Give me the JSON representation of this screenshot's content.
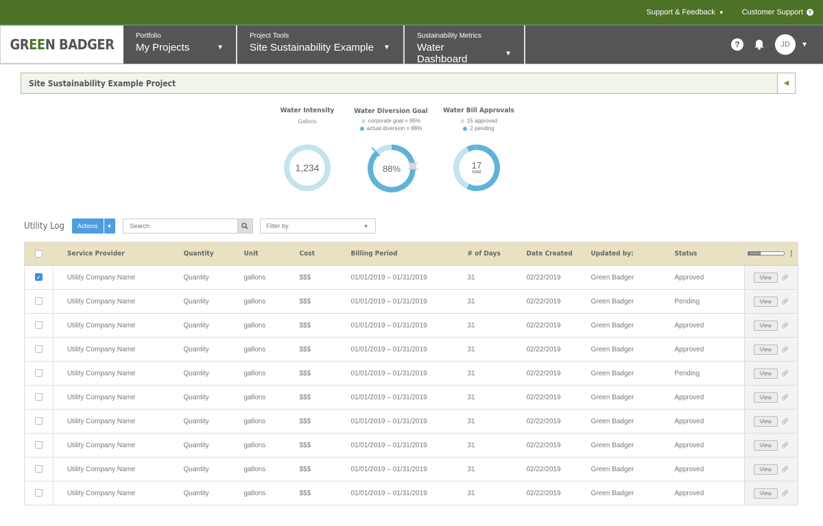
{
  "topbar": {
    "support_feedback": "Support & Feedback",
    "customer_support": "Customer Support"
  },
  "nav": {
    "logo_left": "GR",
    "logo_mid": "EE",
    "logo_right": "N BADGER",
    "sections": [
      {
        "label": "Portfolio",
        "value": "My Projects"
      },
      {
        "label": "Project Tools",
        "value": "Site Sustainability Example"
      },
      {
        "label": "Sustainability Metrics",
        "value": "Water Dashboard"
      }
    ],
    "help": "?",
    "avatar_initials": "JD"
  },
  "project": {
    "title": "Site Sustainability Example Project"
  },
  "metrics": {
    "intensity": {
      "title": "Water Intensity",
      "subtitle": "Gallons",
      "value": "1,234"
    },
    "diversion": {
      "title": "Water Diversion Goal",
      "legend": [
        "corporate goal = 95%",
        "actual diversion = 88%"
      ],
      "value": "88%",
      "goal_pct": 95,
      "actual_pct": 88
    },
    "approvals": {
      "title": "Water Bill Approvals",
      "legend": [
        "15 approved",
        "2 pending"
      ],
      "value": "17",
      "value_sub": "total",
      "approved": 15,
      "pending": 2
    }
  },
  "colors": {
    "light_blue": "#c4e4ed",
    "dark_blue": "#5fb3d9",
    "brand_green": "#4b7226"
  },
  "utility": {
    "title": "Utility Log",
    "actions": "Actions",
    "search_placeholder": "Search",
    "filter": "Filter by",
    "columns": [
      "Service Provider",
      "Quantity",
      "Unit",
      "Cost",
      "Billing Period",
      "# of Days",
      "Date Created",
      "Updated by:",
      "Status"
    ],
    "view_label": "View",
    "rows": [
      {
        "checked": true,
        "provider": "Utility Company Name",
        "quantity": "Quantity",
        "unit": "gallons",
        "cost": "$$$",
        "period": "01/01/2019 – 01/31/2019",
        "days": "31",
        "created": "02/22/2019",
        "updated": "Green Badger",
        "status": "Approved"
      },
      {
        "checked": false,
        "provider": "Utility Company Name",
        "quantity": "Quantity",
        "unit": "gallons",
        "cost": "$$$",
        "period": "01/01/2019 – 01/31/2019",
        "days": "31",
        "created": "02/22/2019",
        "updated": "Green Badger",
        "status": "Pending"
      },
      {
        "checked": false,
        "provider": "Utility Company Name",
        "quantity": "Quantity",
        "unit": "gallons",
        "cost": "$$$",
        "period": "01/01/2019 – 01/31/2019",
        "days": "31",
        "created": "02/22/2019",
        "updated": "Green Badger",
        "status": "Approved"
      },
      {
        "checked": false,
        "provider": "Utility Company Name",
        "quantity": "Quantity",
        "unit": "gallons",
        "cost": "$$$",
        "period": "01/01/2019 – 01/31/2019",
        "days": "31",
        "created": "02/22/2019",
        "updated": "Green Badger",
        "status": "Approved"
      },
      {
        "checked": false,
        "provider": "Utility Company Name",
        "quantity": "Quantity",
        "unit": "gallons",
        "cost": "$$$",
        "period": "01/01/2019 – 01/31/2019",
        "days": "31",
        "created": "02/22/2019",
        "updated": "Green Badger",
        "status": "Pending"
      },
      {
        "checked": false,
        "provider": "Utility Company Name",
        "quantity": "Quantity",
        "unit": "gallons",
        "cost": "$$$",
        "period": "01/01/2019 – 01/31/2019",
        "days": "31",
        "created": "02/22/2019",
        "updated": "Green Badger",
        "status": "Approved"
      },
      {
        "checked": false,
        "provider": "Utility Company Name",
        "quantity": "Quantity",
        "unit": "gallons",
        "cost": "$$$",
        "period": "01/01/2019 – 01/31/2019",
        "days": "31",
        "created": "02/22/2019",
        "updated": "Green Badger",
        "status": "Approved"
      },
      {
        "checked": false,
        "provider": "Utility Company Name",
        "quantity": "Quantity",
        "unit": "gallons",
        "cost": "$$$",
        "period": "01/01/2019 – 01/31/2019",
        "days": "31",
        "created": "02/22/2019",
        "updated": "Green Badger",
        "status": "Approved"
      },
      {
        "checked": false,
        "provider": "Utility Company Name",
        "quantity": "Quantity",
        "unit": "gallons",
        "cost": "$$$",
        "period": "01/01/2019 – 01/31/2019",
        "days": "31",
        "created": "02/22/2019",
        "updated": "Green Badger",
        "status": "Approved"
      },
      {
        "checked": false,
        "provider": "Utility Company Name",
        "quantity": "Quantity",
        "unit": "gallons",
        "cost": "$$$",
        "period": "01/01/2019 – 01/31/2019",
        "days": "31",
        "created": "02/22/2019",
        "updated": "Green Badger",
        "status": "Approved"
      }
    ]
  }
}
